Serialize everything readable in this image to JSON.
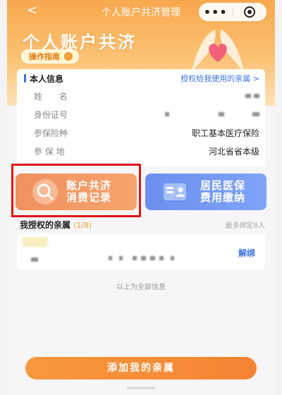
{
  "nav": {
    "back": "<",
    "title": "个人账户共济管理"
  },
  "capsule": {
    "more_label": "•••"
  },
  "hero": {
    "title": "个人账户共济",
    "guide_label": "操作指南"
  },
  "info": {
    "title": "本人信息",
    "auth_link": "授权给我使用的亲属 >",
    "rows": [
      {
        "key": "姓　　名",
        "value": ""
      },
      {
        "key": "身份证号",
        "value": ""
      },
      {
        "key": "参保险种",
        "value": "职工基本医疗保险"
      },
      {
        "key": "参  保  地",
        "value": "河北省省本级"
      }
    ]
  },
  "tiles": {
    "record_line1": "账户共济",
    "record_line2": "消费记录",
    "pay_line1": "居民医保",
    "pay_line2": "费用缴纳"
  },
  "relatives": {
    "title": "我授权的亲属",
    "count": "(1/8)",
    "limit": "最多绑定8人",
    "unbind": "解绑",
    "footer": "以上为全部信息"
  },
  "add_button": "添加我的亲属",
  "colors": {
    "accent": "#f7983e",
    "link": "#3a72e0",
    "record_tile": "#f09060",
    "pay_tile": "#6c8ff0",
    "highlight": "#e01414"
  }
}
